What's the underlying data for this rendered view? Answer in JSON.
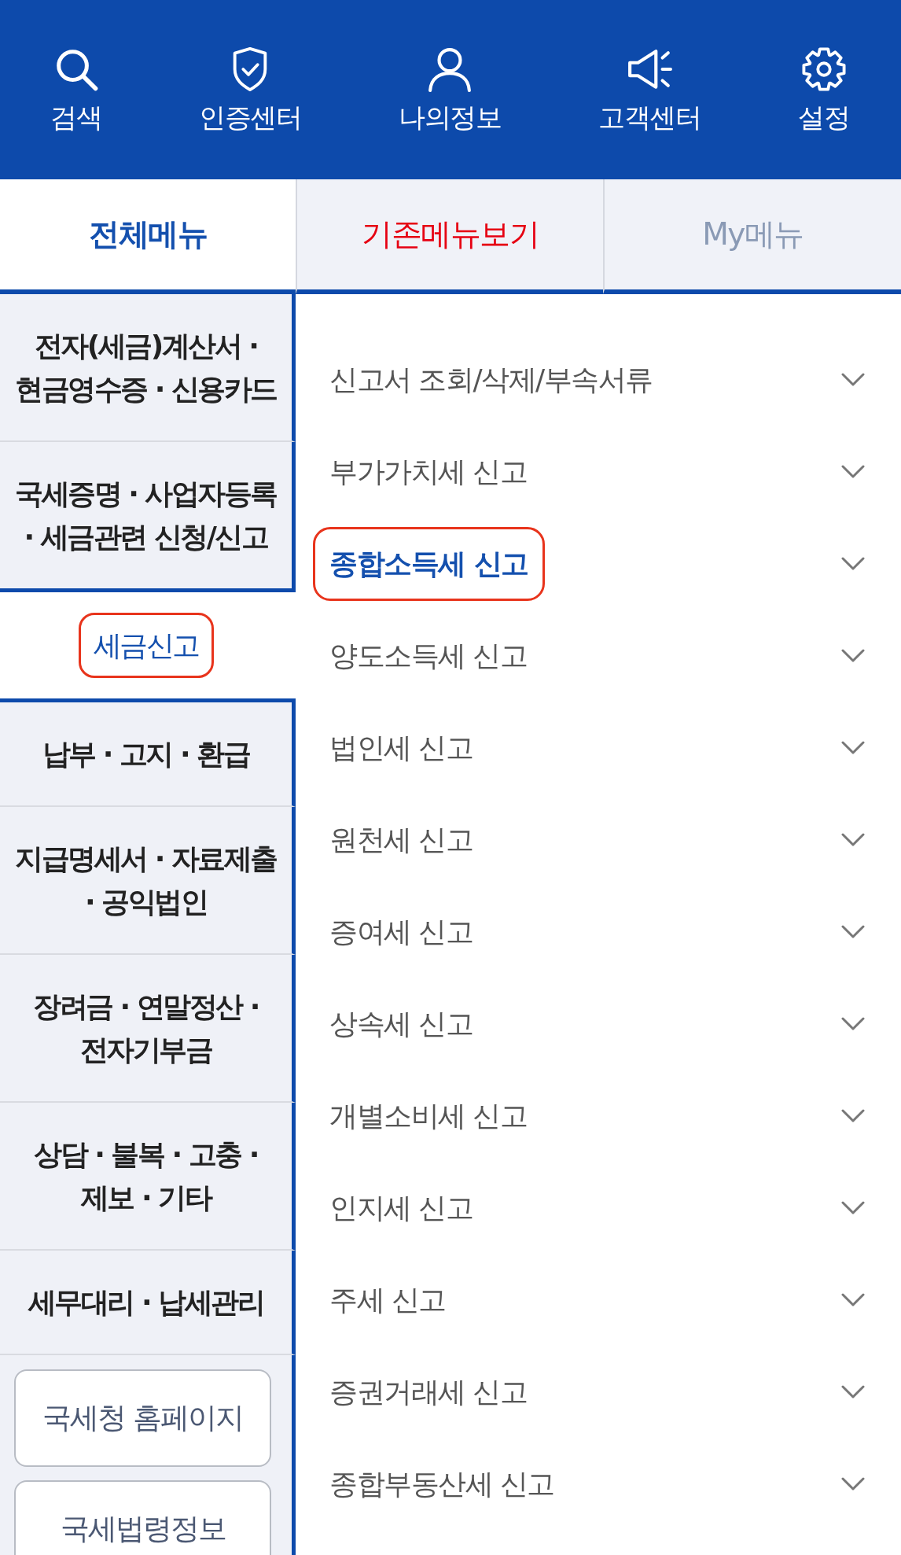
{
  "header": {
    "items": [
      {
        "kind": "search",
        "label": "검색"
      },
      {
        "kind": "shield",
        "label": "인증센터"
      },
      {
        "kind": "person",
        "label": "나의정보"
      },
      {
        "kind": "megaphone",
        "label": "고객센터"
      },
      {
        "kind": "gear",
        "label": "설정"
      }
    ]
  },
  "tabs": [
    {
      "label": "전체메뉴",
      "selected": true,
      "color": "#1450ae"
    },
    {
      "label": "기존메뉴보기",
      "selected": false,
      "color": "#e60012"
    },
    {
      "label": "My메뉴",
      "selected": false,
      "color": "#8a9ab5"
    }
  ],
  "categories": [
    {
      "label": "전자(세금)계산서 ·\n현금영수증 · 신용카드",
      "selected": false
    },
    {
      "label": "국세증명 · 사업자등록\n· 세금관련 신청/신고",
      "selected": false
    },
    {
      "label": "세금신고",
      "selected": true
    },
    {
      "label": "납부 · 고지 · 환급",
      "selected": false
    },
    {
      "label": "지급명세서 · 자료제출\n· 공익법인",
      "selected": false
    },
    {
      "label": "장려금 · 연말정산 ·\n전자기부금",
      "selected": false
    },
    {
      "label": "상담 · 불복 · 고충 ·\n제보 · 기타",
      "selected": false
    },
    {
      "label": "세무대리 · 납세관리",
      "selected": false
    }
  ],
  "links": [
    "국세청 홈페이지",
    "국세법령정보"
  ],
  "submenu": [
    {
      "label": "신고서 조회/삭제/부속서류",
      "selected": false,
      "expanded": false
    },
    {
      "label": "부가가치세 신고",
      "selected": false,
      "expanded": false
    },
    {
      "label": "종합소득세 신고",
      "selected": true,
      "expanded": false
    },
    {
      "label": "양도소득세 신고",
      "selected": false,
      "expanded": false
    },
    {
      "label": "법인세 신고",
      "selected": false,
      "expanded": false
    },
    {
      "label": "원천세 신고",
      "selected": false,
      "expanded": false
    },
    {
      "label": "증여세 신고",
      "selected": false,
      "expanded": false
    },
    {
      "label": "상속세 신고",
      "selected": false,
      "expanded": false
    },
    {
      "label": "개별소비세 신고",
      "selected": false,
      "expanded": false
    },
    {
      "label": "인지세 신고",
      "selected": false,
      "expanded": false
    },
    {
      "label": "주세 신고",
      "selected": false,
      "expanded": false
    },
    {
      "label": "증권거래세 신고",
      "selected": false,
      "expanded": false
    },
    {
      "label": "종합부동산세 신고",
      "selected": false,
      "expanded": false
    }
  ]
}
